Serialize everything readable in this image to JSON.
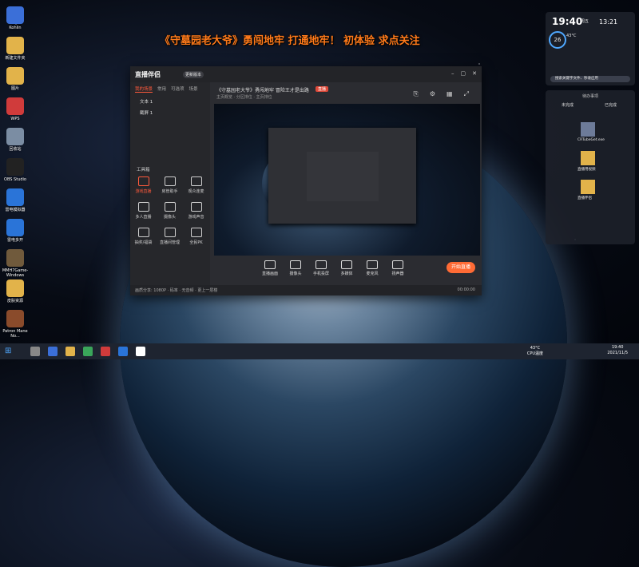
{
  "banner": "《守墓园老大爷》勇闯地牢 打通地牢！ 初体验 求点关注",
  "desktop_icons_left": [
    {
      "label": "Kohlin",
      "color": "#3b6fd8"
    },
    {
      "label": "新建文件夹",
      "color": "#e2b34a"
    },
    {
      "label": "图片",
      "color": "#e2b34a"
    },
    {
      "label": "WPS",
      "color": "#d03b3b"
    },
    {
      "label": "回收站",
      "color": "#7b8da3"
    },
    {
      "label": "OBS Studio",
      "color": "#222"
    },
    {
      "label": "雷电模拟器",
      "color": "#2a74d8"
    },
    {
      "label": "雷电多开",
      "color": "#2a74d8"
    },
    {
      "label": "MMH7Game-Windows",
      "color": "#705a3c"
    },
    {
      "label": "皮肤资源",
      "color": "#e2b34a"
    },
    {
      "label": "Patron Mane No...",
      "color": "#8a4b2b"
    }
  ],
  "window": {
    "app_name": "直播伴侣",
    "version": "更新版本",
    "sidebar_tabs": [
      "我的场景",
      "常用",
      "可选项",
      "场景"
    ],
    "scenes": [
      "文本 1",
      "截屏 1"
    ],
    "tools_title": "工具箱",
    "tools": [
      "游戏直播",
      "房管助手",
      "观众连麦",
      "多人直播",
      "摄像头",
      "游戏声音",
      "抽奖/福袋",
      "直播间管理",
      "全民PK"
    ],
    "preview_title": "《守墓园老大爷》勇闯地牢 冒险王才是出路",
    "live_badge": "直播",
    "preview_sub": "主页概览 · 分区排位 · 主页排位",
    "bottom_tools": [
      "直播画面",
      "摄像头",
      "手机投屏",
      "多媒体",
      "麦克风",
      "扬声器"
    ],
    "start_label": "开始直播",
    "status": "画质分享: 1080P · 码率 · 无音频 · 更上一层楼",
    "duration": "00:00:00"
  },
  "widget": {
    "time": "19:40",
    "date": "周五",
    "time2": "13:21",
    "temp": "26",
    "cpu": "43°C",
    "search_placeholder": "搜索关键字文件、秒收应用"
  },
  "todo": {
    "title": "待办事项",
    "col1": "未完成",
    "col2": "已完成",
    "items": [
      "CRTubeGet.exe",
      "直播用视频",
      "直播伴侣"
    ]
  },
  "taskbar": {
    "temp": "43°C",
    "cpu_label": "CPU温度",
    "time": "19:40",
    "date": "2021/11/5"
  }
}
